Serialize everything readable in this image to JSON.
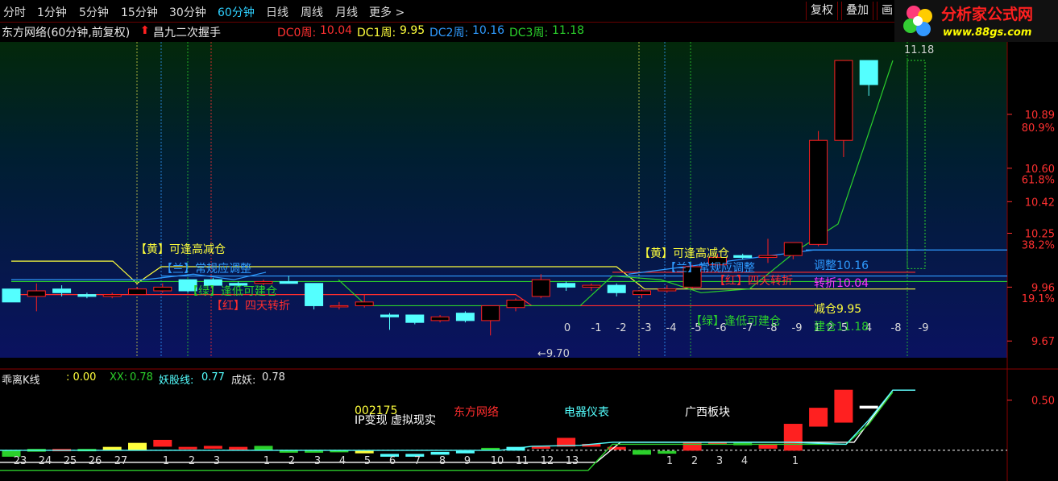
{
  "toolbar": {
    "timeframes": [
      "分时",
      "1分钟",
      "5分钟",
      "15分钟",
      "30分钟",
      "60分钟",
      "日线",
      "周线",
      "月线",
      "更多 >"
    ],
    "active_index": 5,
    "buttons": [
      "复权",
      "叠加",
      "画"
    ]
  },
  "logo": {
    "title": "分析家公式网",
    "url": "www.88gs.com"
  },
  "info_bar": {
    "stock_title": "东方网络(60分钟,前复权)",
    "formula_name": "昌九二次握手",
    "dc0_label": "DC0周:",
    "dc0_value": "10.04",
    "dc1_label": "DC1周:",
    "dc1_value": "9.95",
    "dc2_label": "DC2周:",
    "dc2_value": "10.16",
    "dc3_label": "DC3周:",
    "dc3_value": "11.18"
  },
  "indicator_bar": {
    "name": "乖离K线",
    "value0": ": 0.00",
    "xx_label": "XX:",
    "xx_value": "0.78",
    "yao_label": "妖股线:",
    "yao_value": "0.77",
    "cheng_label": "成妖:",
    "cheng_value": "0.78"
  },
  "colors": {
    "up": "#ff2020",
    "down": "#54ffff",
    "yellow": "#ffff3c",
    "blue": "#2f9bff",
    "green": "#2bd02b",
    "red": "#ff2d2d",
    "magenta": "#ff33ff",
    "white": "#ffffff"
  },
  "chart_data": [
    {
      "type": "candlestick",
      "panel": "main",
      "ylim": [
        9.58,
        11.28
      ],
      "y_ticks": [
        10.89,
        10.6,
        10.42,
        10.25,
        9.96,
        9.67
      ],
      "pct_ticks": [
        {
          "value": 10.82,
          "label": "80.9%"
        },
        {
          "value": 10.54,
          "label": "61.8%"
        },
        {
          "value": 10.19,
          "label": "38.2%"
        },
        {
          "value": 9.9,
          "label": "19.1%"
        }
      ],
      "candles": [
        [
          9.95,
          9.95,
          9.88,
          9.88
        ],
        [
          9.91,
          9.98,
          9.83,
          9.94
        ],
        [
          9.95,
          9.97,
          9.91,
          9.93
        ],
        [
          9.92,
          9.93,
          9.9,
          9.91
        ],
        [
          9.91,
          9.93,
          9.9,
          9.92
        ],
        [
          9.92,
          9.96,
          9.92,
          9.95
        ],
        [
          9.94,
          9.98,
          9.93,
          9.96
        ],
        [
          10.0,
          10.0,
          9.93,
          9.94
        ],
        [
          10.0,
          10.01,
          9.96,
          9.97
        ],
        [
          9.98,
          9.99,
          9.96,
          9.97
        ],
        [
          9.98,
          10.0,
          9.97,
          9.99
        ],
        [
          9.99,
          10.02,
          9.98,
          9.98
        ],
        [
          9.98,
          9.98,
          9.84,
          9.86
        ],
        [
          9.86,
          9.88,
          9.84,
          9.86
        ],
        [
          9.86,
          9.92,
          9.85,
          9.88
        ],
        [
          9.81,
          9.82,
          9.73,
          9.8
        ],
        [
          9.81,
          9.81,
          9.76,
          9.77
        ],
        [
          9.78,
          9.81,
          9.77,
          9.8
        ],
        [
          9.82,
          9.83,
          9.77,
          9.78
        ],
        [
          9.78,
          9.86,
          9.7,
          9.86
        ],
        [
          9.85,
          9.9,
          9.83,
          9.89
        ],
        [
          9.91,
          10.03,
          9.9,
          10.0
        ],
        [
          9.98,
          9.99,
          9.94,
          9.96
        ],
        [
          9.96,
          9.98,
          9.94,
          9.97
        ],
        [
          9.97,
          9.98,
          9.91,
          9.93
        ],
        [
          9.92,
          9.95,
          9.9,
          9.94
        ],
        [
          9.94,
          9.97,
          9.93,
          9.95
        ],
        [
          9.96,
          10.08,
          9.95,
          10.07
        ],
        [
          10.08,
          10.14,
          10.06,
          10.12
        ],
        [
          10.13,
          10.14,
          10.11,
          10.12
        ],
        [
          10.12,
          10.22,
          10.09,
          10.13
        ],
        [
          10.13,
          10.2,
          10.11,
          10.2
        ],
        [
          10.19,
          10.8,
          10.18,
          10.75
        ],
        [
          10.75,
          11.1,
          10.66,
          11.18
        ],
        [
          11.18,
          11.18,
          10.99,
          11.05
        ]
      ],
      "annotations": {
        "high": "11.18",
        "low": "←9.70",
        "countdown": [
          "0",
          "-1",
          "-2",
          "-3",
          "-4",
          "-5",
          "-6",
          "-7",
          "-8",
          "-9",
          "1",
          "2",
          "5",
          "4",
          "-8",
          "-9"
        ]
      },
      "legend_left": {
        "yellow": "【黄】可逢高减仓",
        "blue": "【兰】常规应调整",
        "green": "【绿】逢低可建仓",
        "red": "【红】四天转折"
      },
      "legend_right": {
        "yellow": "【黄】可逢高减仓",
        "blue": "【兰】常规应调整",
        "green": "【绿】逢低可建仓",
        "red": "【红】四天转折"
      },
      "right_labels": {
        "adjust": "调整10.16",
        "turn": "转折10.04",
        "reduce": "减仓9.95",
        "build": "建仓11.18"
      },
      "levels": {
        "yellow": 9.95,
        "blue": 10.16,
        "red": 10.04,
        "green": 11.18
      }
    },
    {
      "type": "candlestick",
      "panel": "indicator",
      "ylim": [
        -0.25,
        0.65
      ],
      "y_ticks": [
        0.5
      ],
      "count_labels": [
        "23",
        "24",
        "25",
        "26",
        "27",
        "1",
        "2",
        "3",
        "1",
        "2",
        "3",
        "4",
        "5",
        "6",
        "7",
        "8",
        "9",
        "10",
        "11",
        "12",
        "13",
        "1",
        "2",
        "3",
        "4",
        "1"
      ],
      "sector_tags": {
        "code": "002175",
        "concept": "IP变现 虚拟现实",
        "name": "东方网络",
        "industry": "电器仪表",
        "region": "广西板块"
      }
    }
  ]
}
